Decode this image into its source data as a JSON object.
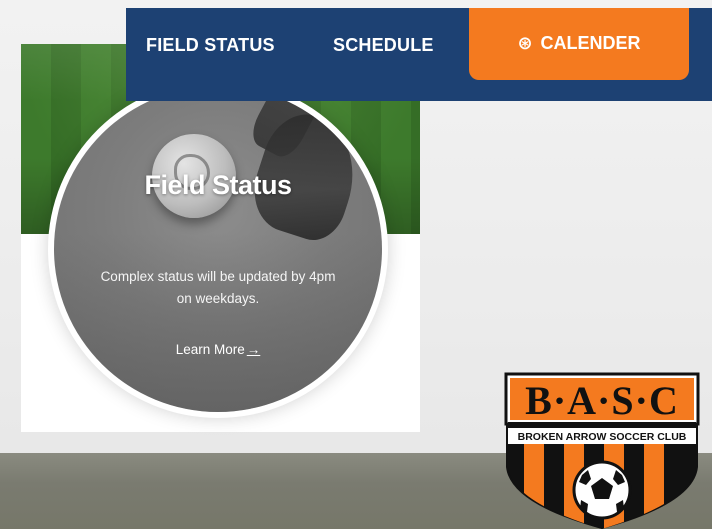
{
  "nav": {
    "items": [
      {
        "label": "FIELD STATUS"
      },
      {
        "label": "SCHEDULE"
      }
    ],
    "calendar": {
      "label": "CALENDER",
      "icon": "soccer-ball-icon"
    },
    "background_color": "#1d4173",
    "accent_color": "#f47a1f"
  },
  "card": {
    "title": "Field Status",
    "description": "Complex status will be updated by 4pm on weekdays.",
    "link_label": "Learn More",
    "link_icon": "arrow-right-icon"
  },
  "logo": {
    "letters": "B·A·S·C",
    "club_name": "BROKEN ARROW SOCCER CLUB",
    "colors": {
      "orange": "#f47a1f",
      "black": "#111111"
    }
  }
}
